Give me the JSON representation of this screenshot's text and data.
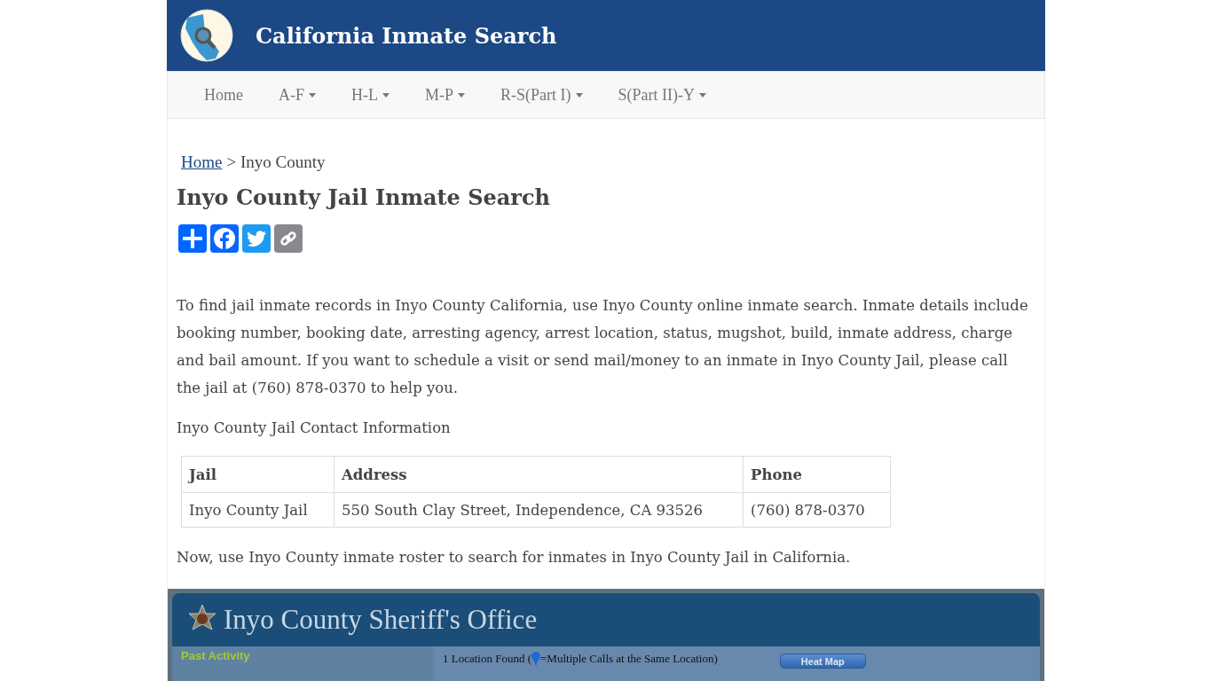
{
  "header": {
    "title": "California Inmate Search"
  },
  "nav": [
    {
      "label": "Home",
      "dropdown": false
    },
    {
      "label": "A-F",
      "dropdown": true
    },
    {
      "label": "H-L",
      "dropdown": true
    },
    {
      "label": "M-P",
      "dropdown": true
    },
    {
      "label": "R-S(Part I)",
      "dropdown": true
    },
    {
      "label": "S(Part II)-Y",
      "dropdown": true
    }
  ],
  "breadcrumb": {
    "link": "Home",
    "current": "> Inyo County"
  },
  "heading": "Inyo County Jail Inmate Search",
  "share": [
    {
      "kind": "share"
    },
    {
      "kind": "facebook"
    },
    {
      "kind": "twitter"
    },
    {
      "kind": "copy"
    }
  ],
  "intro": "To find jail inmate records in Inyo County California, use Inyo County online inmate search. Inmate details include booking number, booking date, arresting agency, arrest location, status, mugshot, build, inmate address, charge and bail amount. If you want to schedule a visit or send mail/money to an inmate in Inyo County Jail, please call the jail at (760) 878-0370 to help you.",
  "contact_heading": "Inyo County Jail Contact Information",
  "table": {
    "columns": [
      "Jail",
      "Address",
      "Phone"
    ],
    "rows": [
      [
        "Inyo County Jail",
        "550 South Clay Street, Independence, CA 93526",
        "(760) 878-0370"
      ]
    ]
  },
  "roster_note": "Now, use Inyo County inmate roster to search for inmates in Inyo County Jail in California.",
  "embed": {
    "title": "Inyo County Sheriff's Office",
    "sidebar_heading": "Past Activity",
    "found_before": "1 Location Found (",
    "found_after": "=Multiple Calls at the Same Location)",
    "heat_button": "Heat Map"
  }
}
